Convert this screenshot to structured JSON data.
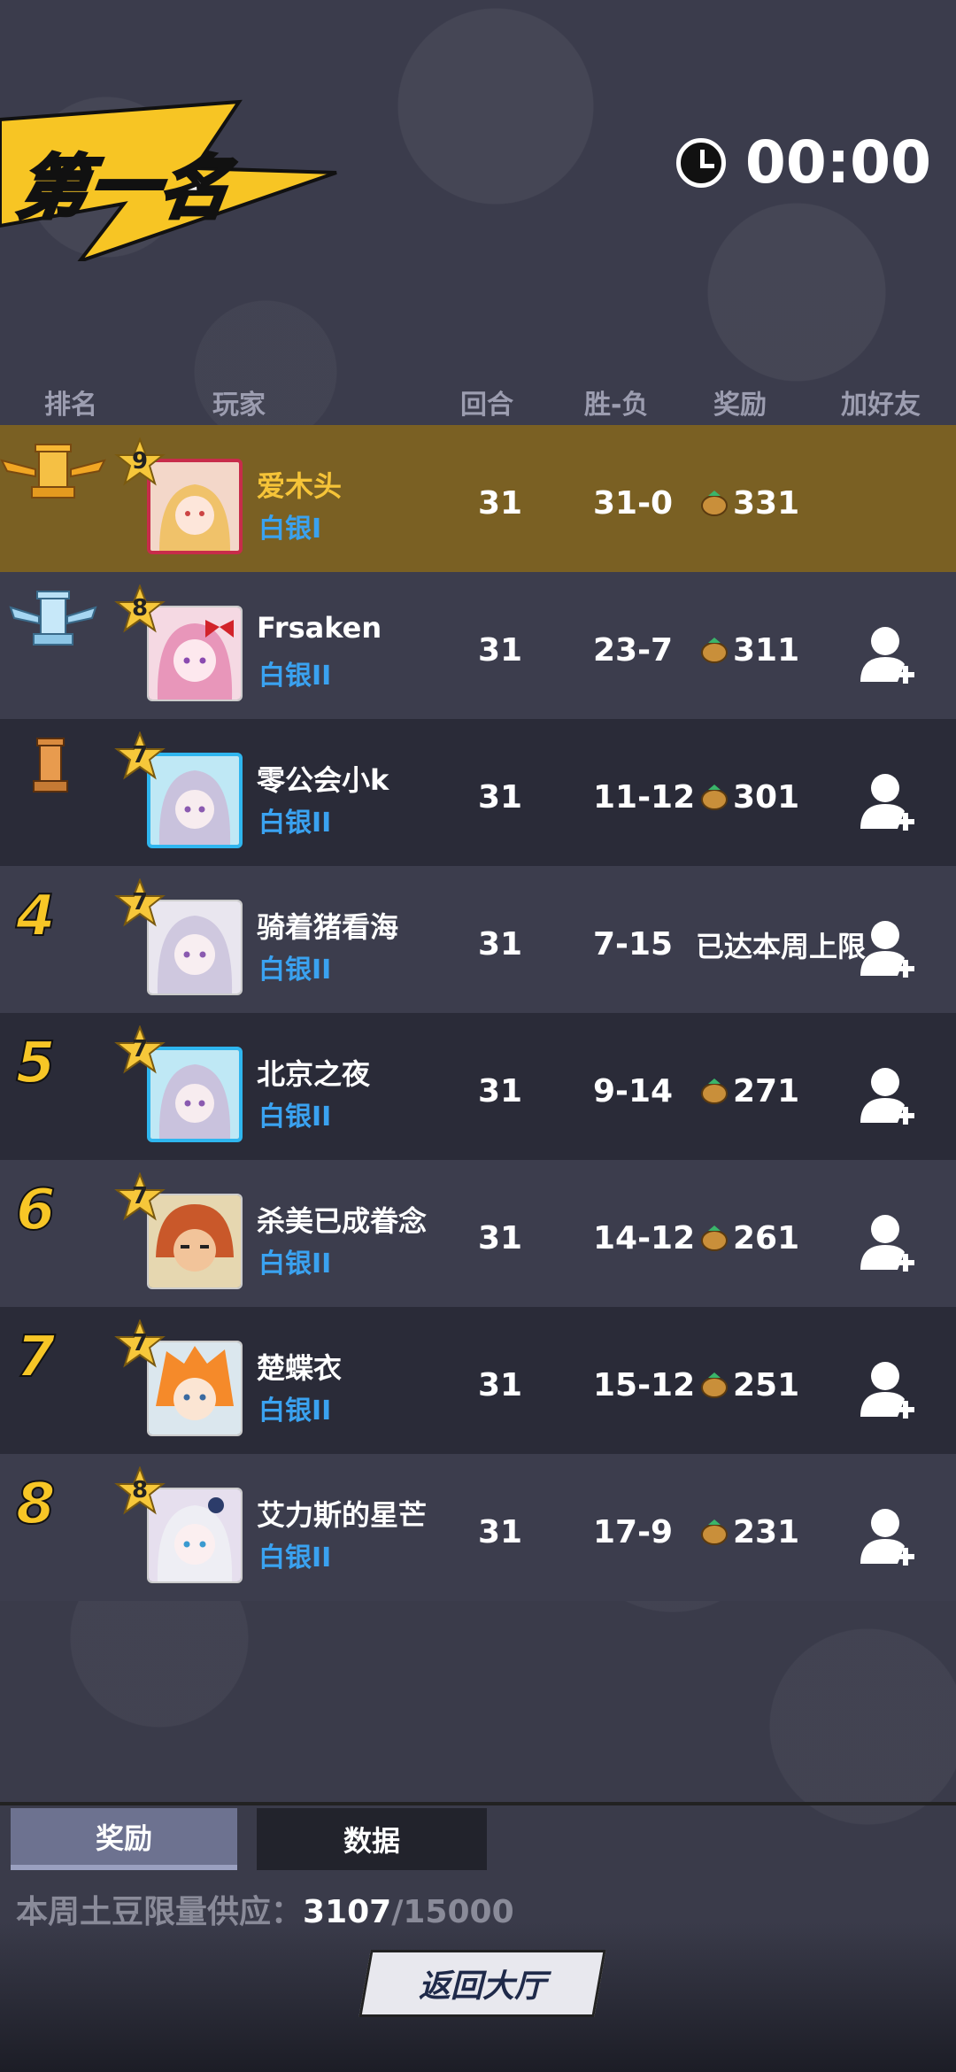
{
  "banner": {
    "title": "第一名"
  },
  "timer": {
    "value": "00:00"
  },
  "headers": {
    "rank": "排名",
    "player": "玩家",
    "rounds": "回合",
    "winloss": "胜-负",
    "reward": "奖励",
    "addfriend": "加好友"
  },
  "rows": [
    {
      "rank": "1",
      "level": "9",
      "name": "爱木头",
      "tier": "白银I",
      "rounds": "31",
      "winloss": "31-0",
      "reward": "331"
    },
    {
      "rank": "2",
      "level": "8",
      "name": "Frsaken",
      "tier": "白银II",
      "rounds": "31",
      "winloss": "23-7",
      "reward": "311"
    },
    {
      "rank": "3",
      "level": "7",
      "name": "零公会小k",
      "tier": "白银II",
      "rounds": "31",
      "winloss": "11-12",
      "reward": "301"
    },
    {
      "rank": "4",
      "level": "7",
      "name": "骑着猪看海",
      "tier": "白银II",
      "rounds": "31",
      "winloss": "7-15",
      "reward": "已达本周上限"
    },
    {
      "rank": "5",
      "level": "7",
      "name": "北京之夜",
      "tier": "白银II",
      "rounds": "31",
      "winloss": "9-14",
      "reward": "271"
    },
    {
      "rank": "6",
      "level": "7",
      "name": "杀美已成眷念",
      "tier": "白银II",
      "rounds": "31",
      "winloss": "14-12",
      "reward": "261"
    },
    {
      "rank": "7",
      "level": "7",
      "name": "楚蝶衣",
      "tier": "白银II",
      "rounds": "31",
      "winloss": "15-12",
      "reward": "251"
    },
    {
      "rank": "8",
      "level": "8",
      "name": "艾力斯的星芒",
      "tier": "白银II",
      "rounds": "31",
      "winloss": "17-9",
      "reward": "231"
    }
  ],
  "tabs": {
    "reward": "奖励",
    "data": "数据"
  },
  "supply": {
    "label": "本周土豆限量供应：",
    "current": "3107",
    "total": "/15000"
  },
  "back_button": "返回大厅",
  "colors": {
    "gold": "#f6c438",
    "tier_blue": "#3aa2f0",
    "first_row": "#7a6023"
  }
}
